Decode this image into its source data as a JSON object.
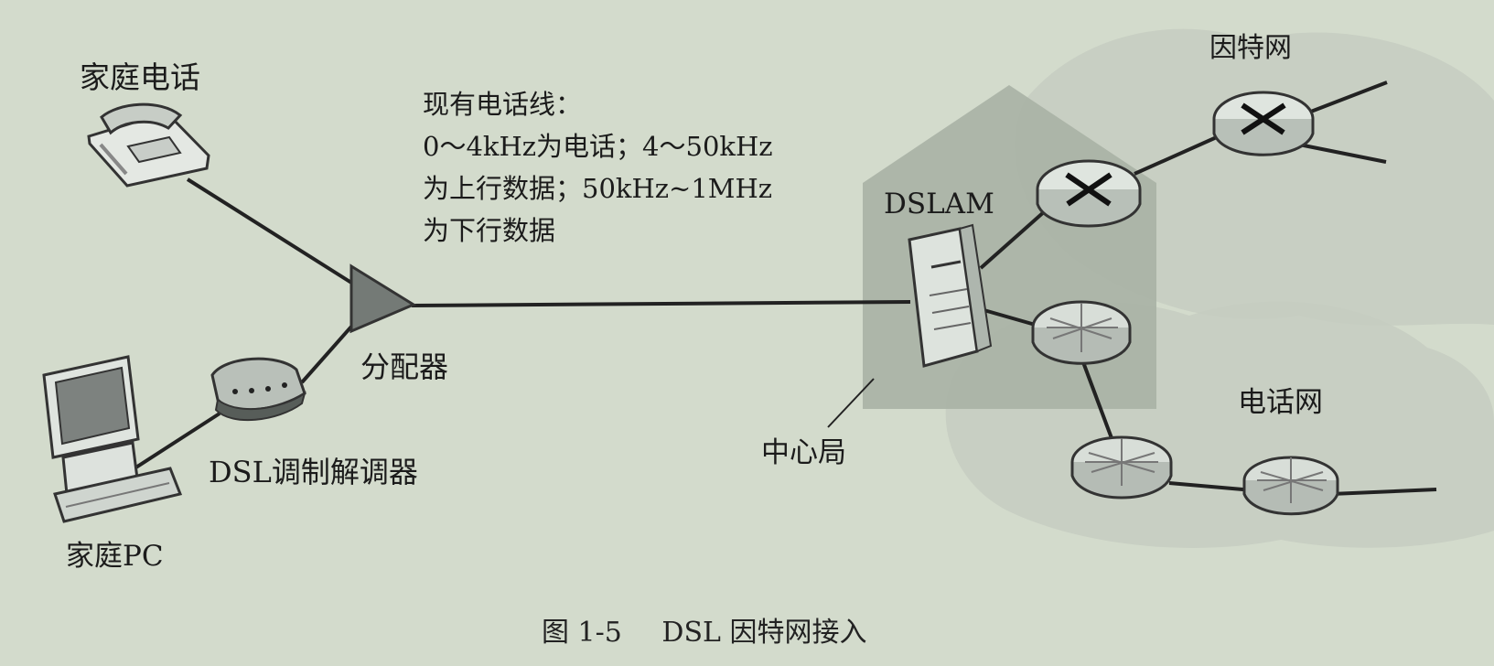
{
  "labels": {
    "home_phone": "家庭电话",
    "home_pc": "家庭PC",
    "dsl_modem": "DSL调制解调器",
    "splitter": "分配器",
    "dslam": "DSLAM",
    "central_office": "中心局",
    "internet": "因特网",
    "telephone_network": "电话网"
  },
  "line_note": [
    "现有电话线：",
    "0～4kHz为电话；4～50kHz",
    "为上行数据；50kHz~1MHz",
    "为下行数据"
  ],
  "caption": {
    "number": "图 1-5",
    "title": "DSL 因特网接入"
  },
  "icons": {
    "phone": "telephone-icon",
    "computer": "desktop-computer-icon",
    "modem": "dsl-modem-icon",
    "splitter": "splitter-icon",
    "dslam": "dslam-server-icon",
    "router": "router-icon",
    "switch": "telephone-switch-icon"
  }
}
